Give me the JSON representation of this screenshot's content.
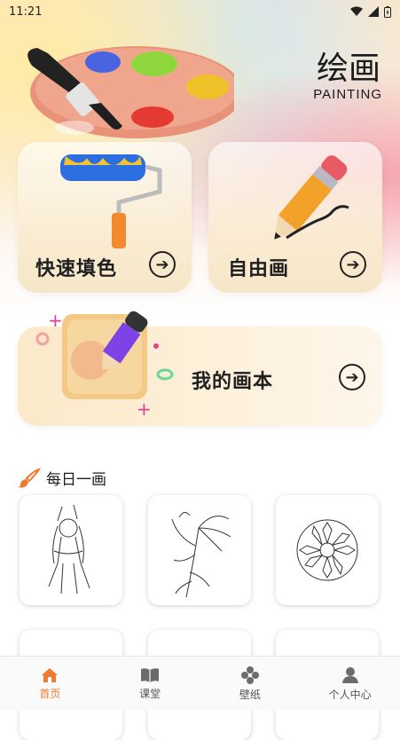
{
  "status_bar": {
    "time": "11:21"
  },
  "header": {
    "title": "绘画",
    "subtitle": "PAINTING"
  },
  "cards": {
    "quick_fill": {
      "label": "快速填色"
    },
    "free_draw": {
      "label": "自由画"
    },
    "my_book": {
      "label": "我的画本"
    }
  },
  "daily": {
    "title": "每日一画"
  },
  "tabs": [
    {
      "label": "首页",
      "icon": "home-icon",
      "active": true
    },
    {
      "label": "课堂",
      "icon": "book-icon",
      "active": false
    },
    {
      "label": "壁纸",
      "icon": "wallpaper-icon",
      "active": false
    },
    {
      "label": "个人中心",
      "icon": "person-icon",
      "active": false
    }
  ],
  "colors": {
    "accent": "#f07a2e",
    "card_bg": "#f6e6c8"
  }
}
